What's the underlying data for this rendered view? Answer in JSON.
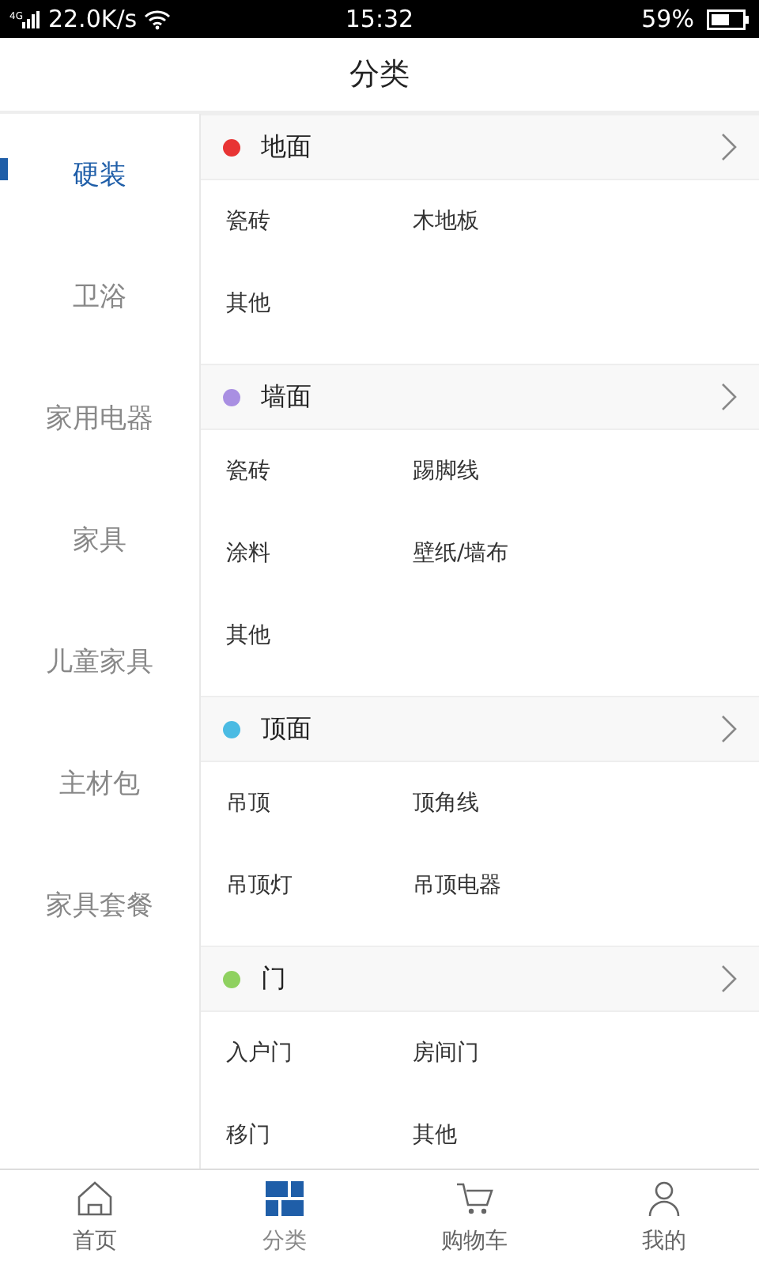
{
  "status_bar": {
    "network": "4G",
    "speed": "22.0K/s",
    "time": "15:32",
    "battery": "59%"
  },
  "header": {
    "title": "分类"
  },
  "sidebar": {
    "items": [
      {
        "label": "硬装",
        "selected": true
      },
      {
        "label": "卫浴",
        "selected": false
      },
      {
        "label": "家用电器",
        "selected": false
      },
      {
        "label": "家具",
        "selected": false
      },
      {
        "label": "儿童家具",
        "selected": false
      },
      {
        "label": "主材包",
        "selected": false
      },
      {
        "label": "家具套餐",
        "selected": false
      }
    ]
  },
  "sections": [
    {
      "title": "地面",
      "color": "#e83434",
      "items": [
        "瓷砖",
        "木地板",
        "其他"
      ]
    },
    {
      "title": "墙面",
      "color": "#a98fe2",
      "items": [
        "瓷砖",
        "踢脚线",
        "涂料",
        "壁纸/墙布",
        "其他"
      ]
    },
    {
      "title": "顶面",
      "color": "#4bbbe3",
      "items": [
        "吊顶",
        "顶角线",
        "吊顶灯",
        "吊顶电器"
      ]
    },
    {
      "title": "门",
      "color": "#8fd160",
      "items": [
        "入户门",
        "房间门",
        "移门",
        "其他"
      ]
    }
  ],
  "tab_bar": [
    {
      "label": "首页",
      "kind": "home",
      "selected": false
    },
    {
      "label": "分类",
      "kind": "category",
      "selected": true
    },
    {
      "label": "购物车",
      "kind": "cart",
      "selected": false
    },
    {
      "label": "我的",
      "kind": "profile",
      "selected": false
    }
  ]
}
